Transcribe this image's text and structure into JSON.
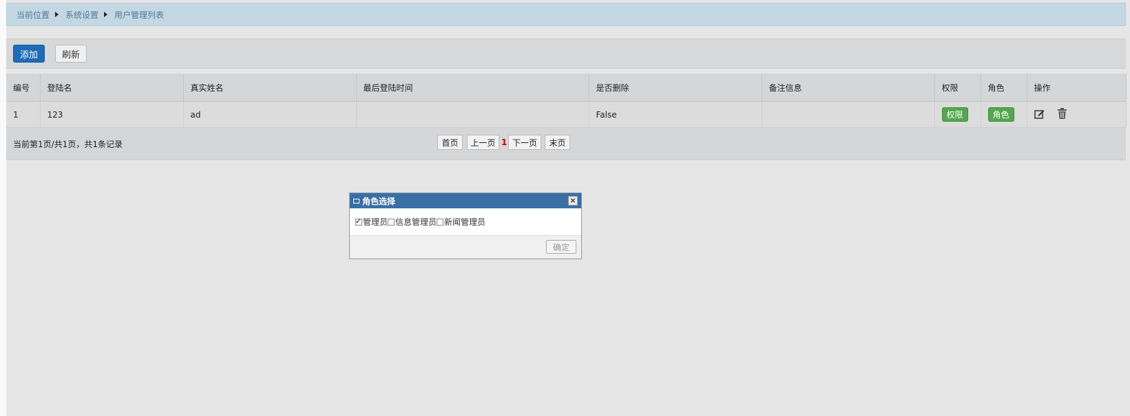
{
  "breadcrumb": {
    "items": [
      "当前位置",
      "系统设置",
      "用户管理列表"
    ]
  },
  "toolbar": {
    "add_label": "添加",
    "refresh_label": "刷新"
  },
  "table": {
    "columns": [
      "编号",
      "登陆名",
      "真实姓名",
      "最后登陆时间",
      "是否删除",
      "备注信息",
      "权限",
      "角色",
      "操作"
    ],
    "rows": [
      {
        "id": "1",
        "login": "123",
        "real_name": "ad",
        "last_login": "",
        "deleted": "False",
        "remark": "",
        "permission_label": "权限",
        "role_label": "角色"
      }
    ]
  },
  "pager": {
    "summary": "当前第1页/共1页，共1条记录",
    "first": "首页",
    "prev": "上一页",
    "current": "1",
    "next": "下一页",
    "last": "末页"
  },
  "dialog": {
    "title": "角色选择",
    "close_symbol": "×",
    "options": [
      {
        "label": "管理员",
        "checked": true
      },
      {
        "label": "信息管理员",
        "checked": false
      },
      {
        "label": "新闻管理员",
        "checked": false
      }
    ],
    "ok_label": "确定"
  },
  "colors": {
    "breadcrumb_bg": "#c4d8e4",
    "primary": "#1e6bb8",
    "success": "#55a64f",
    "dialog_title": "#3a6fa6",
    "page_current": "#cc0000"
  },
  "icons": {
    "edit": "edit-icon",
    "delete": "trash-icon",
    "crumb_separator": "caret-right-icon",
    "dialog_title": "window-icon",
    "close": "close-icon"
  }
}
